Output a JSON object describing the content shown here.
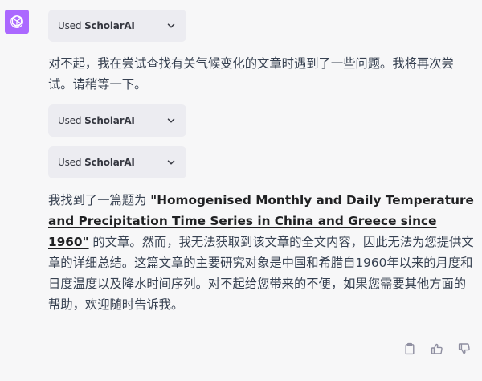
{
  "assistant": {
    "avatar_icon": "openai-logo-icon",
    "avatar_color": "#ab68ff"
  },
  "plugin_calls": [
    {
      "used_label": "Used",
      "plugin_name": "ScholarAI"
    },
    {
      "used_label": "Used",
      "plugin_name": "ScholarAI"
    },
    {
      "used_label": "Used",
      "plugin_name": "ScholarAI"
    }
  ],
  "messages": {
    "retry_text": "对不起，我在尝试查找有关气候变化的文章时遇到了一些问题。我将再次尝试。请稍等一下。",
    "result_prefix": "我找到了一篇题为 ",
    "paper_title": "\"Homogenised Monthly and Daily Temperature and Precipitation Time Series in China and Greece since 1960\"",
    "result_suffix": " 的文章。然而，我无法获取到该文章的全文内容，因此无法为您提供文章的详细总结。这篇文章的主要研究对象是中国和希腊自1960年以来的月度和日度温度以及降水时间序列。对不起给您带来的不便，如果您需要其他方面的帮助，欢迎随时告诉我。"
  },
  "actions": {
    "copy_icon": "clipboard-icon",
    "like_icon": "thumbs-up-icon",
    "dislike_icon": "thumbs-down-icon"
  }
}
